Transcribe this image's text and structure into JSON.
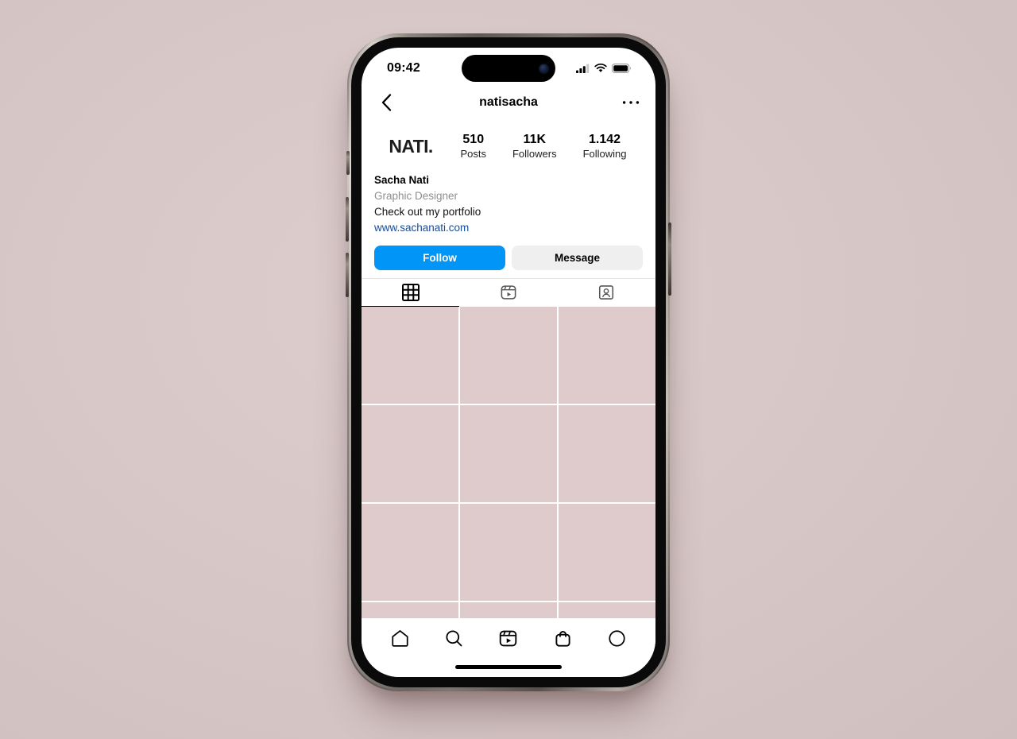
{
  "background_color": "#d8c8c8",
  "device": {
    "name": "iphone-15-pro",
    "frame_color": "#0a0a0a",
    "rail_color": "#8d857f"
  },
  "status_bar": {
    "time": "09:42",
    "icons": [
      "cellular-signal-icon",
      "wifi-icon",
      "battery-icon"
    ],
    "battery_level": 100
  },
  "nav_header": {
    "back_icon": "chevron-left-icon",
    "title": "natisacha",
    "more_icon": "more-options-icon"
  },
  "profile": {
    "avatar_text": "NATI.",
    "stats": [
      {
        "value": "510",
        "label": "Posts"
      },
      {
        "value": "11K",
        "label": "Followers"
      },
      {
        "value": "1.142",
        "label": "Following"
      }
    ],
    "display_name": "Sacha Nati",
    "category": "Graphic Designer",
    "bio_line": "Check out my portfolio",
    "website": "www.sachanati.com",
    "link_color": "#1a4b94"
  },
  "actions": {
    "follow_label": "Follow",
    "follow_color": "#0095f6",
    "message_label": "Message",
    "message_color": "#efefef"
  },
  "tabs": [
    {
      "name": "grid-tab",
      "icon": "grid-icon",
      "active": true
    },
    {
      "name": "reels-tab",
      "icon": "reels-icon",
      "active": false
    },
    {
      "name": "tagged-tab",
      "icon": "tagged-person-icon",
      "active": false
    }
  ],
  "grid": {
    "columns": 3,
    "cell_color": "#dfcbcb",
    "cells": [
      {
        "id": 1
      },
      {
        "id": 2
      },
      {
        "id": 3
      },
      {
        "id": 4
      },
      {
        "id": 5
      },
      {
        "id": 6
      },
      {
        "id": 7
      },
      {
        "id": 8
      },
      {
        "id": 9
      },
      {
        "id": 10
      },
      {
        "id": 11
      },
      {
        "id": 12
      }
    ]
  },
  "bottom_nav": [
    {
      "name": "home-nav",
      "icon": "home-icon"
    },
    {
      "name": "search-nav",
      "icon": "search-icon"
    },
    {
      "name": "reels-nav",
      "icon": "reels-icon"
    },
    {
      "name": "shop-nav",
      "icon": "shopping-bag-icon"
    },
    {
      "name": "profile-nav",
      "icon": "profile-circle-icon"
    }
  ]
}
